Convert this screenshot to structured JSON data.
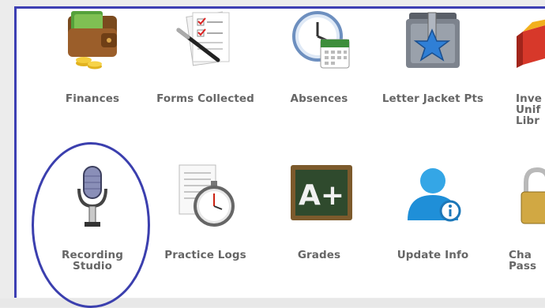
{
  "row1": [
    {
      "id": "finances",
      "label": "Finances",
      "icon": "wallet-icon"
    },
    {
      "id": "forms-collected",
      "label": "Forms Collected",
      "icon": "forms-pen-icon"
    },
    {
      "id": "absences",
      "label": "Absences",
      "icon": "clock-calendar-icon"
    },
    {
      "id": "letter-jacket-pts",
      "label": "Letter Jacket Pts",
      "icon": "star-folder-icon"
    },
    {
      "id": "inventory-uniform-library",
      "label": "Inve\nUnif\nLibr",
      "icon": "boxes-icon"
    }
  ],
  "row2": [
    {
      "id": "recording-studio",
      "label": "Recording\nStudio",
      "icon": "microphone-icon"
    },
    {
      "id": "practice-logs",
      "label": "Practice Logs",
      "icon": "stopwatch-document-icon"
    },
    {
      "id": "grades",
      "label": "Grades",
      "icon": "chalkboard-aplus-icon"
    },
    {
      "id": "update-info",
      "label": "Update Info",
      "icon": "user-info-icon"
    },
    {
      "id": "change-password",
      "label": "Cha\nPass",
      "icon": "padlock-icon"
    }
  ],
  "chalkboard_text": "A+",
  "colors": {
    "frame": "#3d3fb3",
    "label": "#666666",
    "highlight": "#3b3fae"
  }
}
